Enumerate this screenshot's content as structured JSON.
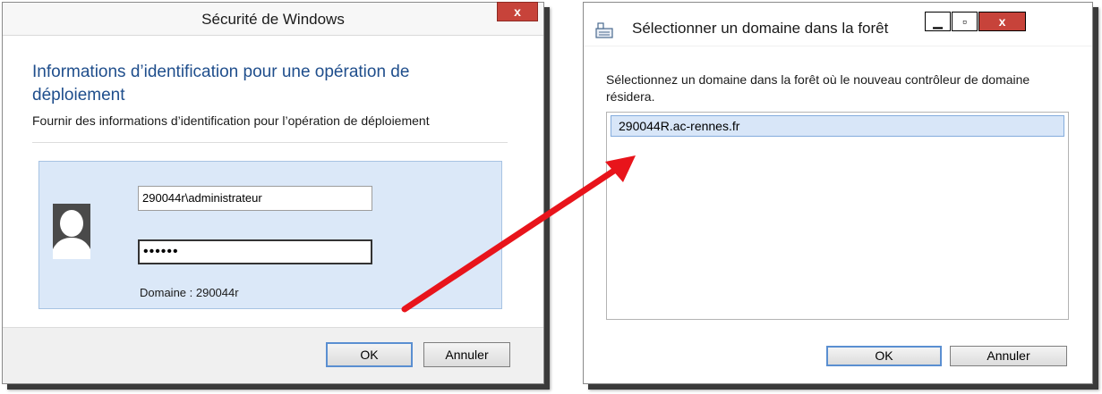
{
  "dialog_credentials": {
    "title": "Sécurité de Windows",
    "close_glyph": "x",
    "heading": "Informations d’identification pour une opération de déploiement",
    "subheading": "Fournir des informations d’identification pour l’opération de déploiement",
    "username_value": "290044r\\administrateur",
    "password_value": "••••••",
    "domain_label": "Domaine : 290044r",
    "ok_label": "OK",
    "cancel_label": "Annuler"
  },
  "dialog_domain": {
    "title": "Sélectionner un domaine dans la forêt",
    "minimize_glyph": "▁",
    "maximize_glyph": "▫",
    "close_glyph": "x",
    "description": "Sélectionnez un domaine dans la forêt où le nouveau contrôleur de domaine résidera.",
    "domains": [
      "290044R.ac-rennes.fr"
    ],
    "ok_label": "OK",
    "cancel_label": "Annuler"
  },
  "colors": {
    "heading_blue": "#1f4e8c",
    "close_red": "#c7433a",
    "panel_blue": "#dbe8f8",
    "arrow_red": "#e8141b"
  },
  "icons": [
    "close-icon",
    "user-avatar-icon",
    "app-icon",
    "minimize-icon",
    "maximize-icon",
    "red-arrow-icon"
  ]
}
